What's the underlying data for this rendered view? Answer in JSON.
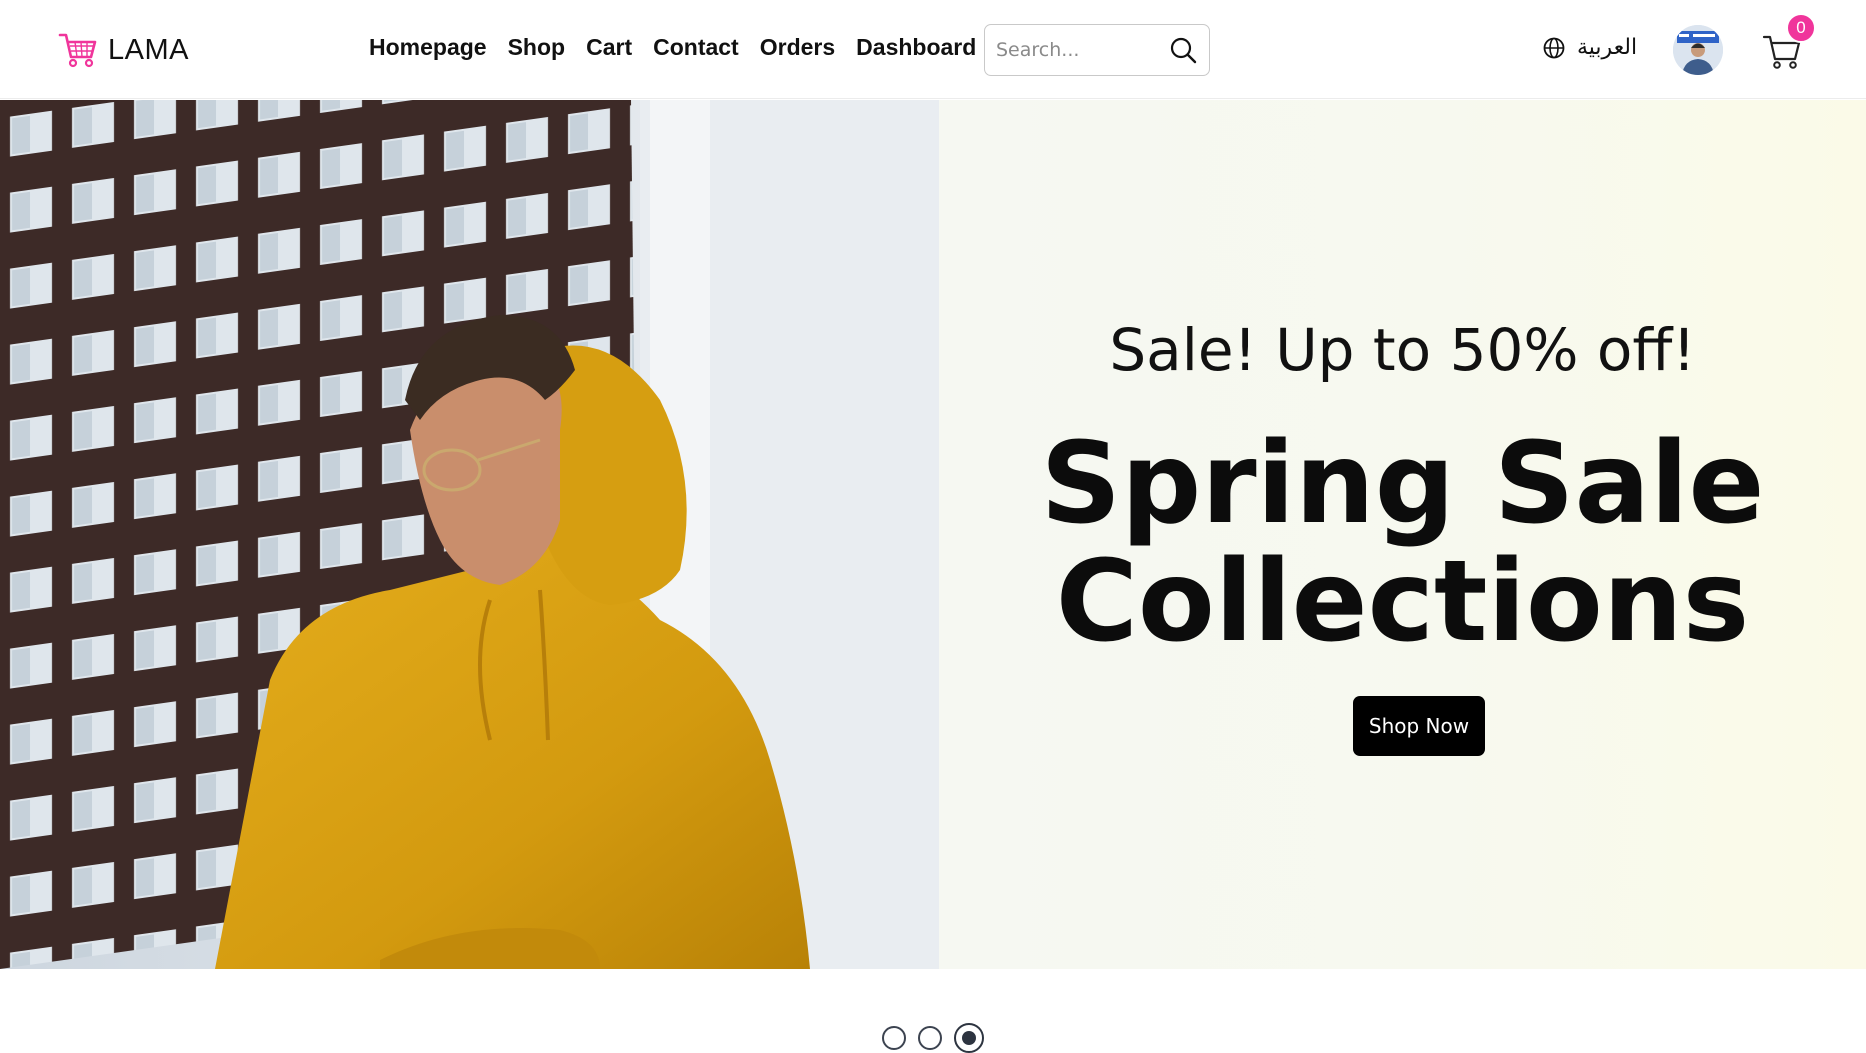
{
  "brand": {
    "name": "LAMA",
    "logo_icon": "shopping-cart-icon",
    "accent": "#f0359b"
  },
  "nav": {
    "links": [
      {
        "label": "Homepage"
      },
      {
        "label": "Shop"
      },
      {
        "label": "Cart"
      },
      {
        "label": "Contact"
      },
      {
        "label": "Orders"
      },
      {
        "label": "Dashboard"
      }
    ]
  },
  "search": {
    "placeholder": "Search...",
    "value": "",
    "icon": "search-icon"
  },
  "language": {
    "label": "العربية",
    "icon": "globe-icon"
  },
  "user": {
    "avatar": "avatar"
  },
  "cart": {
    "icon": "cart-icon",
    "count": "0"
  },
  "hero": {
    "subtitle": "Sale! Up to 50% off!",
    "title_line1": "Spring Sale",
    "title_line2": "Collections",
    "button_label": "Shop Now",
    "slides_total": 3,
    "active_slide": 3
  }
}
